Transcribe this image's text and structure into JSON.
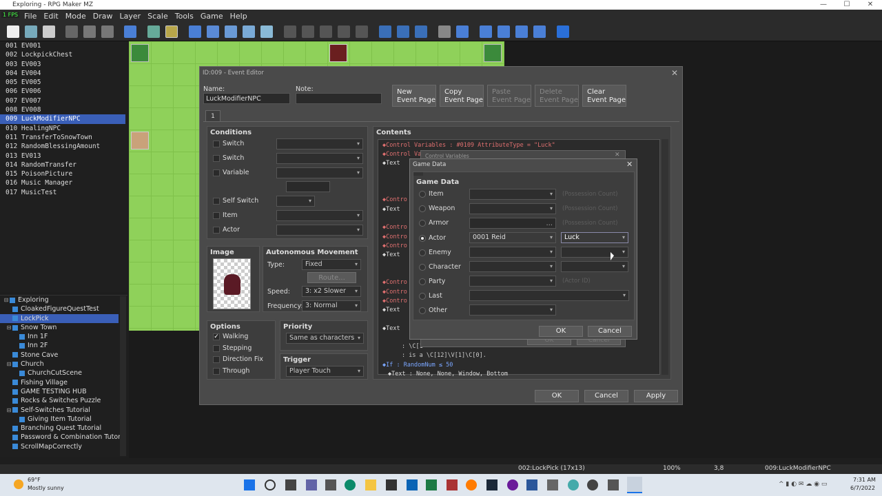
{
  "window": {
    "title": "Exploring - RPG Maker MZ",
    "fps": "1 FPS"
  },
  "menu": [
    "File",
    "Edit",
    "Mode",
    "Draw",
    "Layer",
    "Scale",
    "Tools",
    "Game",
    "Help"
  ],
  "events": [
    "001 EV001",
    "002 LockpickChest",
    "003 EV003",
    "004 EV004",
    "005 EV005",
    "006 EV006",
    "007 EV007",
    "008 EV008",
    "009 LuckModifierNPC",
    "010 HealingNPC",
    "011 TransferToSnowTown",
    "012 RandomBlessingAmount",
    "013 EV013",
    "014 RandomTransfer",
    "015 PoisonPicture",
    "016 Music Manager",
    "017 MusicTest"
  ],
  "maps": [
    "Exploring",
    "CloakedFigureQuestTest",
    "LockPick",
    "Snow Town",
    "Inn 1F",
    "Inn 2F",
    "Stone Cave",
    "Church",
    "ChurchCutScene",
    "Fishing Village",
    "GAME TESTING HUB",
    "Rocks & Switches Puzzle",
    "Self-Switches Tutorial",
    "Giving Item Tutorial",
    "Branching Quest Tutorial",
    "Password & Combination Tutoria",
    "ScrollMapCorrectly"
  ],
  "status": {
    "map": "002:LockPick (17x13)",
    "zoom": "100%",
    "coords": "3,8",
    "event": "009:LuckModifierNPC"
  },
  "taskbar": {
    "weather_temp": "69°F",
    "weather_desc": "Mostly sunny",
    "time": "7:31 AM",
    "date": "6/7/2022"
  },
  "editor": {
    "title": "ID:009 - Event Editor",
    "name_label": "Name:",
    "name_value": "LuckModifierNPC",
    "note_label": "Note:",
    "btn_new": "New\nEvent Page",
    "btn_copy": "Copy\nEvent Page",
    "btn_paste": "Paste\nEvent Page",
    "btn_delete": "Delete\nEvent Page",
    "btn_clear": "Clear\nEvent Page",
    "page_tab": "1",
    "conditions_title": "Conditions",
    "cond": {
      "switch1": "Switch",
      "switch2": "Switch",
      "variable": "Variable",
      "self_switch": "Self Switch",
      "item": "Item",
      "actor": "Actor"
    },
    "image_title": "Image",
    "auto_title": "Autonomous Movement",
    "type_label": "Type:",
    "type_value": "Fixed",
    "route_btn": "Route...",
    "speed_label": "Speed:",
    "speed_value": "3: x2 Slower",
    "freq_label": "Frequency:",
    "freq_value": "3: Normal",
    "options_title": "Options",
    "opt": {
      "walking": "Walking",
      "stepping": "Stepping",
      "direction_fix": "Direction Fix",
      "through": "Through"
    },
    "priority_title": "Priority",
    "priority_value": "Same as characters",
    "trigger_title": "Trigger",
    "trigger_value": "Player Touch",
    "contents_title": "Contents",
    "contents": {
      "l1": "◆Control Variables : #0109 AttributeType = \"Luck\"",
      "l2": "◆Control Va",
      "l3": "◆Text",
      "l4": "◆Contro",
      "l5": "◆Text",
      "l6": "◆Contro",
      "l7": "◆Contro",
      "l8": "◆Contro",
      "l9": "◆Text",
      "l10": "◆Contro",
      "l11": "◆Contro",
      "l12": "◆Contro",
      "l13": "◆Text",
      "l14": "◆Text",
      "l15": ": \\C[1",
      "l16": ": is a \\C[12]\\V[1]\\C[0].",
      "l17": "◆If : RandomNum ≤ 50",
      "l18": "◆Text : None, None, Window, Bottom"
    },
    "ok": "OK",
    "cancel": "Cancel",
    "apply": "Apply"
  },
  "control_variables": {
    "title": "Control Variables",
    "ok": "OK",
    "cancel": "Cancel"
  },
  "game_data": {
    "title": "Game Data",
    "group": "Game Data",
    "rows": {
      "item": "Item",
      "weapon": "Weapon",
      "armor": "Armor",
      "actor": "Actor",
      "enemy": "Enemy",
      "character": "Character",
      "party": "Party",
      "last": "Last",
      "other": "Other"
    },
    "ghost": {
      "possession1": "(Possession Count)",
      "possession2": "(Possession Count)",
      "possession3": "(Possession Count)",
      "actor_id": "(Actor ID)"
    },
    "actor_value": "0001 Reid",
    "attr_value": "Luck",
    "selected": "actor",
    "ok": "OK",
    "cancel": "Cancel"
  }
}
